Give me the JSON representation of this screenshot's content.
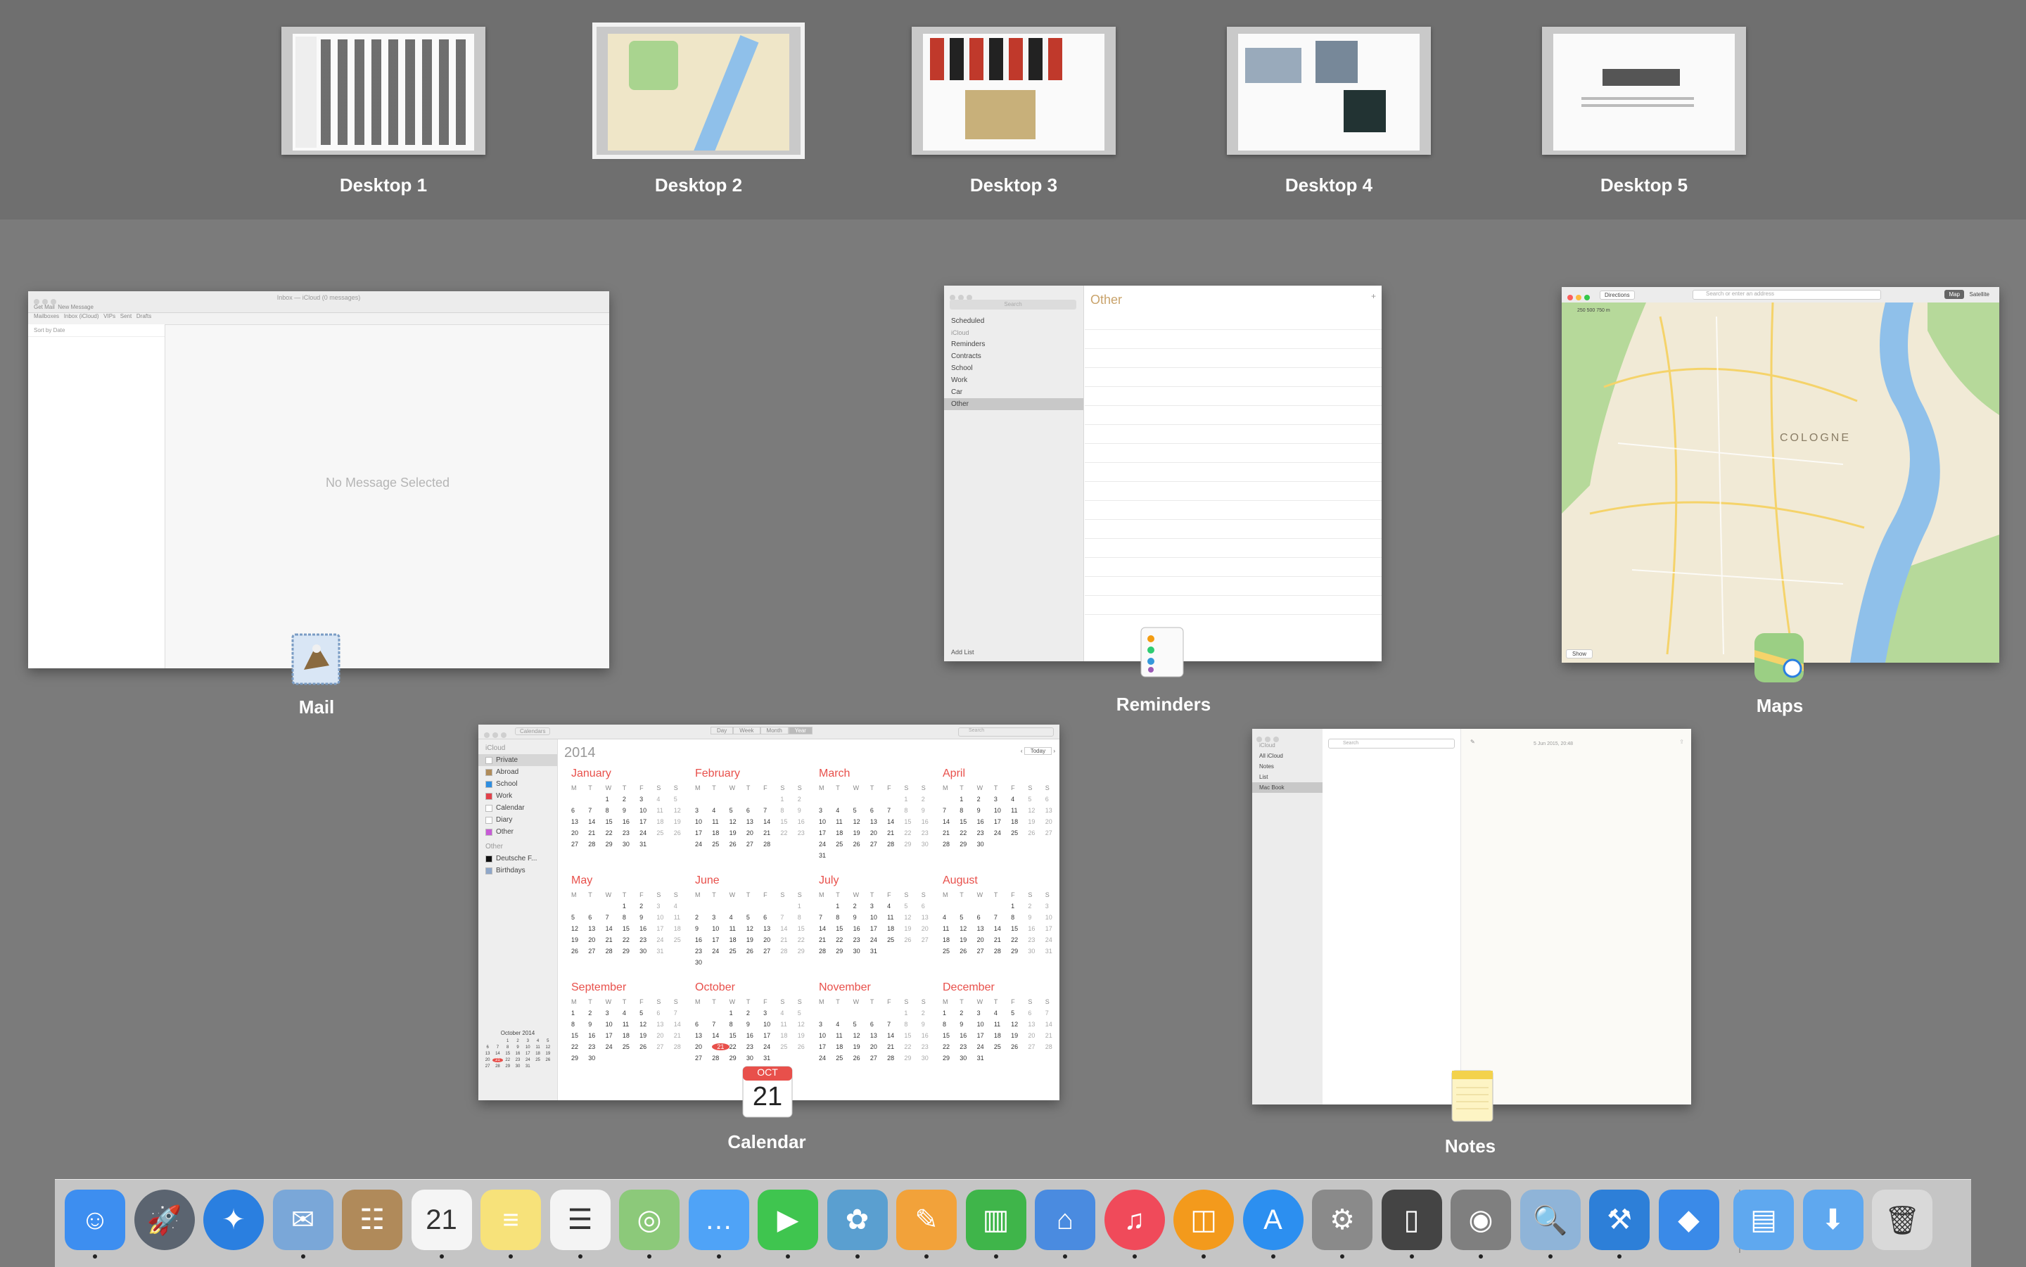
{
  "desktops": [
    {
      "label": "Desktop 1",
      "active": false
    },
    {
      "label": "Desktop 2",
      "active": true
    },
    {
      "label": "Desktop 3",
      "active": false
    },
    {
      "label": "Desktop 4",
      "active": false
    },
    {
      "label": "Desktop 5",
      "active": false
    }
  ],
  "mail": {
    "label": "Mail",
    "window_title": "Inbox — iCloud (0 messages)",
    "toolbar_items": [
      "Get Mail",
      "New Message"
    ],
    "favorites": [
      "Mailboxes",
      "Inbox (iCloud)",
      "VIPs",
      "Sent",
      "Drafts"
    ],
    "sort_text": "Sort by Date",
    "empty_text": "No Message Selected"
  },
  "reminders": {
    "label": "Reminders",
    "search_placeholder": "Search",
    "scheduled": "Scheduled",
    "section": "iCloud",
    "lists": [
      "Reminders",
      "Contracts",
      "School",
      "Work",
      "Car",
      "Other"
    ],
    "selected_list": "Other",
    "title": "Other",
    "add_list": "Add List"
  },
  "maps": {
    "label": "Maps",
    "directions": "Directions",
    "search_placeholder": "Search or enter an address",
    "mode_map": "Map",
    "mode_satellite": "Satellite",
    "city": "COLOGNE",
    "show": "Show",
    "scale": "250   500   750 m"
  },
  "calendar": {
    "label": "Calendar",
    "tb_calendars": "Calendars",
    "views": [
      "Day",
      "Week",
      "Month",
      "Year"
    ],
    "search_placeholder": "Search",
    "year": "2014",
    "today": "Today",
    "section_icloud": "iCloud",
    "calendars": [
      {
        "name": "Private",
        "color": "#ffffff"
      },
      {
        "name": "Abroad",
        "color": "#b08c5a"
      },
      {
        "name": "School",
        "color": "#2f8ee0"
      },
      {
        "name": "Work",
        "color": "#e2414b"
      },
      {
        "name": "Calendar",
        "color": "#ffffff"
      },
      {
        "name": "Diary",
        "color": "#ffffff"
      },
      {
        "name": "Other",
        "color": "#c75bd6"
      }
    ],
    "section_other": "Other",
    "other_calendars": [
      {
        "name": "Deutsche F...",
        "color": "#111111"
      },
      {
        "name": "Birthdays",
        "color": "#8fa7c9"
      }
    ],
    "mini_month": "October 2014",
    "months": [
      "January",
      "February",
      "March",
      "April",
      "May",
      "June",
      "July",
      "August",
      "September",
      "October",
      "November",
      "December"
    ],
    "weekday_letters": [
      "M",
      "T",
      "W",
      "T",
      "F",
      "S",
      "S"
    ],
    "icon_month": "OCT",
    "icon_day": "21"
  },
  "notes": {
    "label": "Notes",
    "search_placeholder": "Search",
    "section": "iCloud",
    "folders": [
      "All iCloud",
      "Notes",
      "List",
      "Mac Book"
    ],
    "selected_folder": "Mac Book",
    "date": "5 Jun 2015, 20:48"
  },
  "dock": {
    "apps": [
      {
        "name": "Finder",
        "icon": "finder-icon",
        "color": "#3d8ef0",
        "glyph": "☺",
        "running": true
      },
      {
        "name": "Launchpad",
        "icon": "launchpad-icon",
        "color": "#5b6470",
        "glyph": "🚀",
        "running": false
      },
      {
        "name": "Safari",
        "icon": "safari-icon",
        "color": "#2a7fe0",
        "glyph": "✦",
        "running": false
      },
      {
        "name": "Mail",
        "icon": "mail-icon",
        "color": "#7aa7d8",
        "glyph": "✉",
        "running": true
      },
      {
        "name": "Contacts",
        "icon": "contacts-icon",
        "color": "#b08a5a",
        "glyph": "☷",
        "running": false
      },
      {
        "name": "Calendar",
        "icon": "calendar-icon",
        "color": "#f5f5f5",
        "glyph": "21",
        "running": true
      },
      {
        "name": "Notes",
        "icon": "notes-icon",
        "color": "#f7e27a",
        "glyph": "≡",
        "running": true
      },
      {
        "name": "Reminders",
        "icon": "reminders-icon",
        "color": "#f4f4f4",
        "glyph": "☰",
        "running": true
      },
      {
        "name": "Maps",
        "icon": "maps-icon",
        "color": "#8cc97a",
        "glyph": "◎",
        "running": true
      },
      {
        "name": "Messages",
        "icon": "messages-icon",
        "color": "#4fa3f7",
        "glyph": "…",
        "running": true
      },
      {
        "name": "FaceTime",
        "icon": "facetime-icon",
        "color": "#3fc54f",
        "glyph": "▶",
        "running": true
      },
      {
        "name": "iPhoto",
        "icon": "iphoto-icon",
        "color": "#5a9fd0",
        "glyph": "✿",
        "running": true
      },
      {
        "name": "Pages",
        "icon": "pages-icon",
        "color": "#f2a23a",
        "glyph": "✎",
        "running": true
      },
      {
        "name": "Numbers",
        "icon": "numbers-icon",
        "color": "#3fb54a",
        "glyph": "▥",
        "running": true
      },
      {
        "name": "Keynote",
        "icon": "keynote-icon",
        "color": "#4a8be0",
        "glyph": "⌂",
        "running": true
      },
      {
        "name": "iTunes",
        "icon": "itunes-icon",
        "color": "#f04a5a",
        "glyph": "♫",
        "running": true
      },
      {
        "name": "iBooks",
        "icon": "ibooks-icon",
        "color": "#f39a1c",
        "glyph": "◫",
        "running": true
      },
      {
        "name": "App Store",
        "icon": "app-store-icon",
        "color": "#2c8ff0",
        "glyph": "A",
        "running": true
      },
      {
        "name": "System Preferences",
        "icon": "system-preferences-icon",
        "color": "#8a8a8a",
        "glyph": "⚙",
        "running": true
      },
      {
        "name": "iOS Simulator",
        "icon": "simulator-icon",
        "color": "#444444",
        "glyph": "▯",
        "running": true
      },
      {
        "name": "Image Capture",
        "icon": "image-capture-icon",
        "color": "#7f7f7f",
        "glyph": "◉",
        "running": true
      },
      {
        "name": "Preview",
        "icon": "preview-icon",
        "color": "#8fb4d8",
        "glyph": "🔍",
        "running": true
      },
      {
        "name": "Xcode",
        "icon": "xcode-icon",
        "color": "#2d7fd8",
        "glyph": "⚒",
        "running": true
      },
      {
        "name": "Developer App",
        "icon": "developer-app-icon",
        "color": "#3a8ae8",
        "glyph": "◆",
        "running": false
      },
      {
        "name": "Documents",
        "icon": "documents-folder-icon",
        "color": "#5fa8ef",
        "glyph": "▤",
        "running": false
      },
      {
        "name": "Downloads",
        "icon": "downloads-folder-icon",
        "color": "#5fa8ef",
        "glyph": "⬇",
        "running": false
      },
      {
        "name": "Trash",
        "icon": "trash-icon",
        "color": "#d9d9d9",
        "glyph": "🗑",
        "running": false
      }
    ]
  }
}
